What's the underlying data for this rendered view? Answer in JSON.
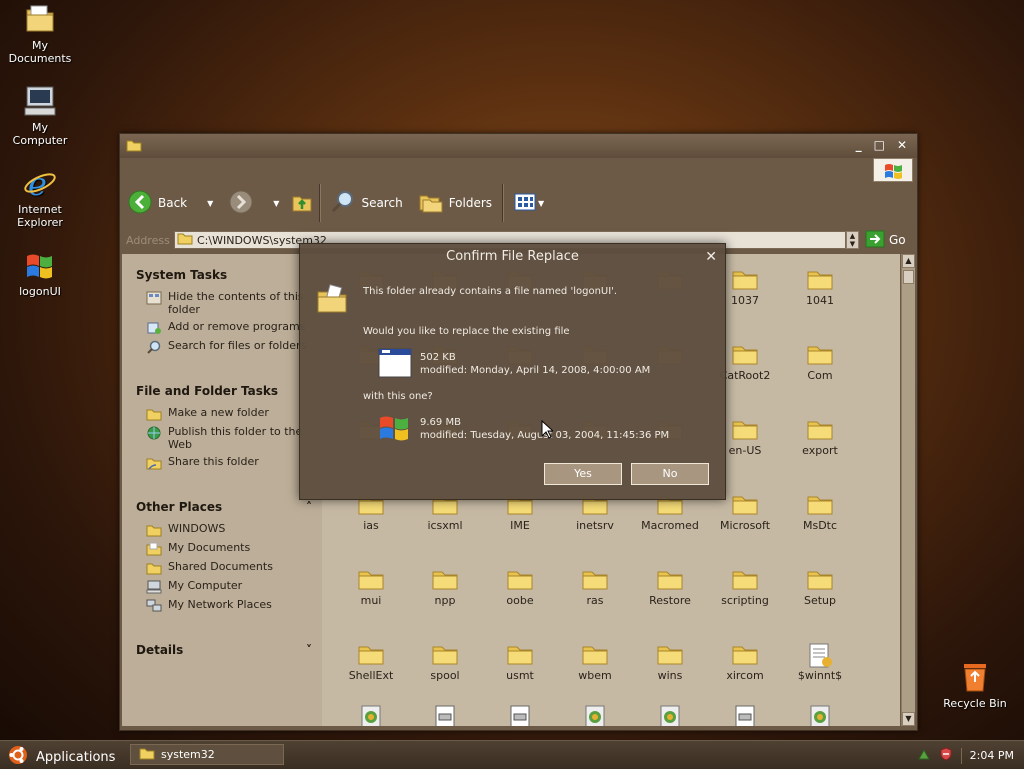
{
  "desktop": {
    "icons": [
      {
        "label": "My\nDocuments"
      },
      {
        "label": "My\nComputer"
      },
      {
        "label": "Internet\nExplorer"
      },
      {
        "label": "logonUI"
      },
      {
        "label": "Recycle Bin"
      }
    ]
  },
  "window": {
    "title_buttons": {
      "minimize": "_",
      "maximize": "□",
      "close": "✕"
    },
    "toolbar": {
      "back": "Back",
      "search": "Search",
      "folders": "Folders"
    },
    "address": {
      "label": "Address",
      "value": "C:\\WINDOWS\\system32",
      "go": "Go"
    },
    "sidepane": {
      "sections": [
        {
          "title": "System Tasks",
          "toggle": "",
          "items": [
            "Hide the contents of this folder",
            "Add or remove programs",
            "Search for files or folders"
          ]
        },
        {
          "title": "File and Folder Tasks",
          "toggle": "",
          "items": [
            "Make a new folder",
            "Publish this folder to the Web",
            "Share this folder"
          ]
        },
        {
          "title": "Other Places",
          "toggle": "˄",
          "items": [
            "WINDOWS",
            "My Documents",
            "Shared Documents",
            "My Computer",
            "My Network Places"
          ]
        },
        {
          "title": "Details",
          "toggle": "˅",
          "items": []
        }
      ]
    },
    "content": {
      "rows": [
        [
          "",
          "",
          "",
          "",
          "",
          "1037",
          "1041"
        ],
        [
          "",
          "",
          "",
          "",
          "",
          "CatRoot2",
          "Com"
        ],
        [
          "",
          "",
          "",
          "",
          "",
          "en-US",
          "export"
        ],
        [
          "ias",
          "icsxml",
          "IME",
          "inetsrv",
          "Macromed",
          "Microsoft",
          "MsDtc"
        ],
        [
          "mui",
          "npp",
          "oobe",
          "ras",
          "Restore",
          "scripting",
          "Setup"
        ],
        [
          "ShellExt",
          "spool",
          "usmt",
          "wbem",
          "wins",
          "xircom",
          "$winnt$"
        ]
      ]
    }
  },
  "dialog": {
    "title": "Confirm File Replace",
    "close": "✕",
    "message": "This folder already contains a file named 'logonUI'.",
    "question": "Would you like to replace the existing file",
    "existing": {
      "size": "502 KB",
      "modified": "modified: Monday, April 14, 2008, 4:00:00 AM"
    },
    "with_label": "with this one?",
    "replacement": {
      "size": "9.69 MB",
      "modified": "modified: Tuesday, August 03, 2004, 11:45:36 PM"
    },
    "yes": "Yes",
    "no": "No"
  },
  "taskbar": {
    "start": "Applications",
    "task": "system32",
    "clock": "2:04 PM"
  }
}
